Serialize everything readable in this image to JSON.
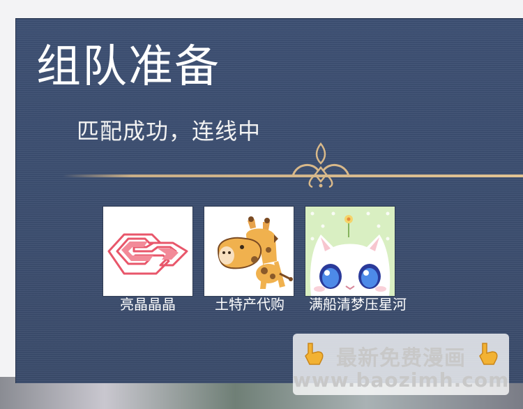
{
  "panel": {
    "title": "组队准备",
    "subtitle": "匹配成功，连线中"
  },
  "team": {
    "members": [
      {
        "name": "亮晶晶晶",
        "avatar": "red-logo-avatar"
      },
      {
        "name": "土特产代购",
        "avatar": "giraffe-avatar"
      },
      {
        "name": "满船清梦压星河",
        "avatar": "white-cat-avatar"
      }
    ]
  },
  "watermark": {
    "line1": "最新免费漫画",
    "line2": "www.baozimh.com",
    "icon": "pointing-hand-icon"
  },
  "colors": {
    "panel": "#3a4d6f",
    "ornament": "#d9b98a",
    "text": "#ffffff"
  }
}
